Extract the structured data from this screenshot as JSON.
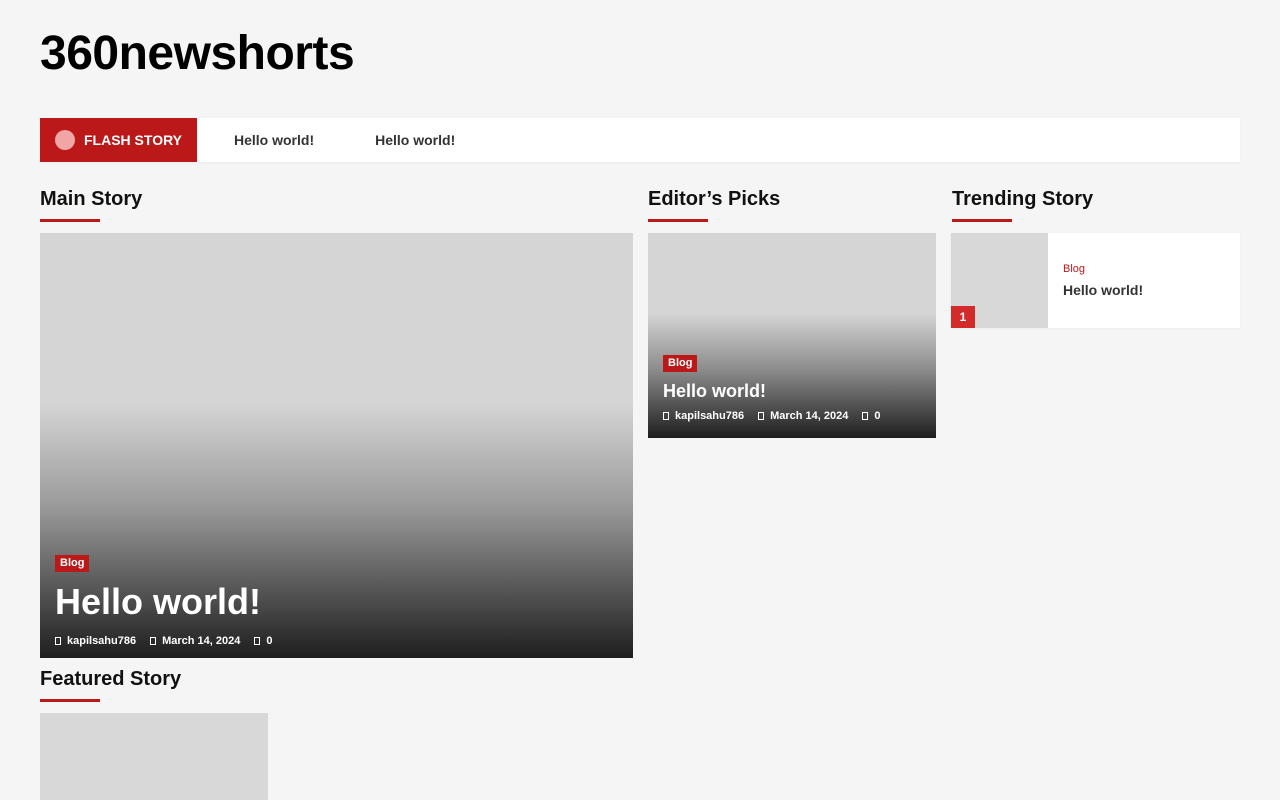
{
  "site": {
    "title": "360newshorts"
  },
  "flash": {
    "label": "FLASH STORY",
    "items": [
      "Hello world!",
      "Hello world!"
    ]
  },
  "sections": {
    "main": "Main Story",
    "editor": "Editor’s Picks",
    "trending": "Trending Story",
    "featured": "Featured Story"
  },
  "main_story": {
    "category": "Blog",
    "title": "Hello world!",
    "author": "kapilsahu786",
    "date": "March 14, 2024",
    "comments": "0"
  },
  "editor_pick": {
    "category": "Blog",
    "title": "Hello world!",
    "author": "kapilsahu786",
    "date": "March 14, 2024",
    "comments": "0"
  },
  "trending": {
    "rank": "1",
    "category": "Blog",
    "title": "Hello world!"
  },
  "colors": {
    "accent": "#bb1919",
    "background": "#f5f5f5",
    "placeholder": "#d5d5d5"
  }
}
